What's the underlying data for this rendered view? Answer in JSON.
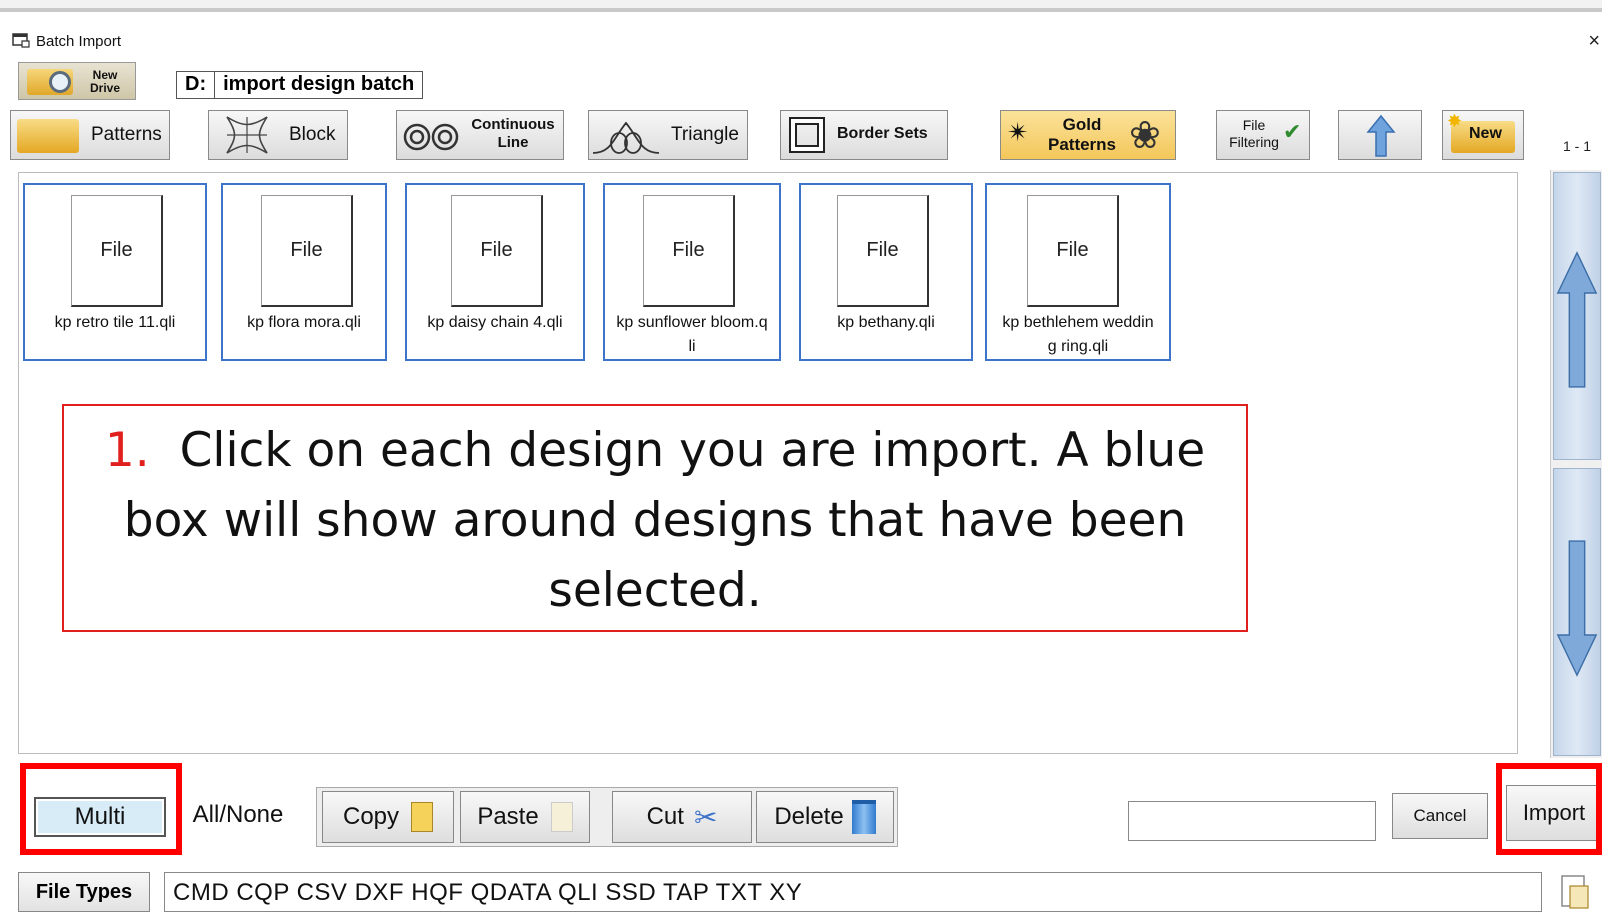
{
  "window": {
    "title": "Batch Import",
    "close": "×"
  },
  "drive": {
    "new_drive_label": "New Drive",
    "letter": "D:",
    "path": "import design batch"
  },
  "toolbar": {
    "patterns": "Patterns",
    "block": "Block",
    "continuous_line": "Continuous Line",
    "triangle": "Triangle",
    "border_sets": "Border Sets",
    "gold_patterns": "Gold Patterns",
    "file_filtering": "File Filtering",
    "new": "New",
    "page_count": "1 - 1"
  },
  "files": [
    {
      "icon_label": "File",
      "name": "kp retro tile 11.qli"
    },
    {
      "icon_label": "File",
      "name": "kp flora mora.qli"
    },
    {
      "icon_label": "File",
      "name": "kp daisy chain 4.qli"
    },
    {
      "icon_label": "File",
      "name": "kp sunflower bloom.qli"
    },
    {
      "icon_label": "File",
      "name": "kp bethany.qli"
    },
    {
      "icon_label": "File",
      "name": "kp bethlehem wedding ring.qli"
    }
  ],
  "callout": {
    "number": "1.",
    "text": "Click on each design you are import. A blue box will show around designs that have been selected."
  },
  "bottom": {
    "multi": "Multi",
    "all_none": "All/None",
    "copy": "Copy",
    "paste": "Paste",
    "cut": "Cut",
    "delete": "Delete",
    "search_value": "",
    "cancel": "Cancel",
    "import": "Import"
  },
  "file_types": {
    "label": "File Types",
    "list": "CMD  CQP  CSV  DXF  HQF  QDATA  QLI  SSD  TAP  TXT  XY"
  },
  "colors": {
    "selection_blue": "#3d74c9",
    "highlight_red": "#ff0000",
    "callout_red": "#e0201d"
  }
}
